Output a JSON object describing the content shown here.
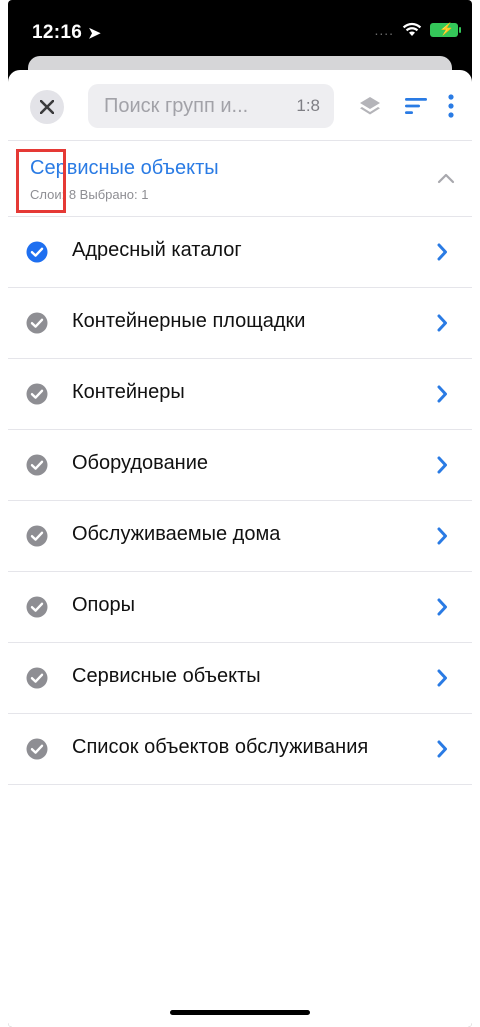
{
  "status_bar": {
    "time": "12:16"
  },
  "toolbar": {
    "search_placeholder": "Поиск групп и...",
    "scale": "1:8"
  },
  "group": {
    "title": "Сервисные объекты",
    "subtitle": "Слои: 8 Выбрано: 1"
  },
  "layers": [
    {
      "label": "Адресный каталог",
      "checked": true
    },
    {
      "label": "Контейнерные площадки",
      "checked": false
    },
    {
      "label": "Контейнеры",
      "checked": false
    },
    {
      "label": "Оборудование",
      "checked": false
    },
    {
      "label": "Обслуживаемые дома",
      "checked": false
    },
    {
      "label": "Опоры",
      "checked": false
    },
    {
      "label": "Сервисные объекты",
      "checked": false
    },
    {
      "label": "Список объектов обслуживания",
      "checked": false
    }
  ],
  "colors": {
    "accent": "#2a7be4",
    "checked": "#1e6ff0",
    "unchecked": "#8e8e93",
    "highlight": "#e53935"
  }
}
